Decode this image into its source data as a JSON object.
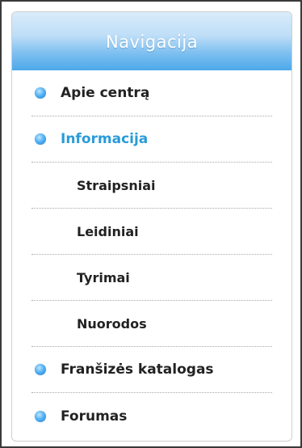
{
  "nav": {
    "title": "Navigacija",
    "items": [
      {
        "label": "Apie centrą",
        "type": "main",
        "active": false
      },
      {
        "label": "Informacija",
        "type": "main",
        "active": true
      },
      {
        "label": "Straipsniai",
        "type": "sub",
        "active": false
      },
      {
        "label": "Leidiniai",
        "type": "sub",
        "active": false
      },
      {
        "label": "Tyrimai",
        "type": "sub",
        "active": false
      },
      {
        "label": "Nuorodos",
        "type": "sub",
        "active": false
      },
      {
        "label": "Franšizės katalogas",
        "type": "main",
        "active": false
      },
      {
        "label": "Forumas",
        "type": "main",
        "active": false
      }
    ]
  },
  "colors": {
    "active_text": "#2a9bd8",
    "bullet": "#3a9ae6",
    "header_gradient_bottom": "#4da8ea"
  },
  "icons": {
    "bullet": "blue-orb-bullet-icon"
  }
}
